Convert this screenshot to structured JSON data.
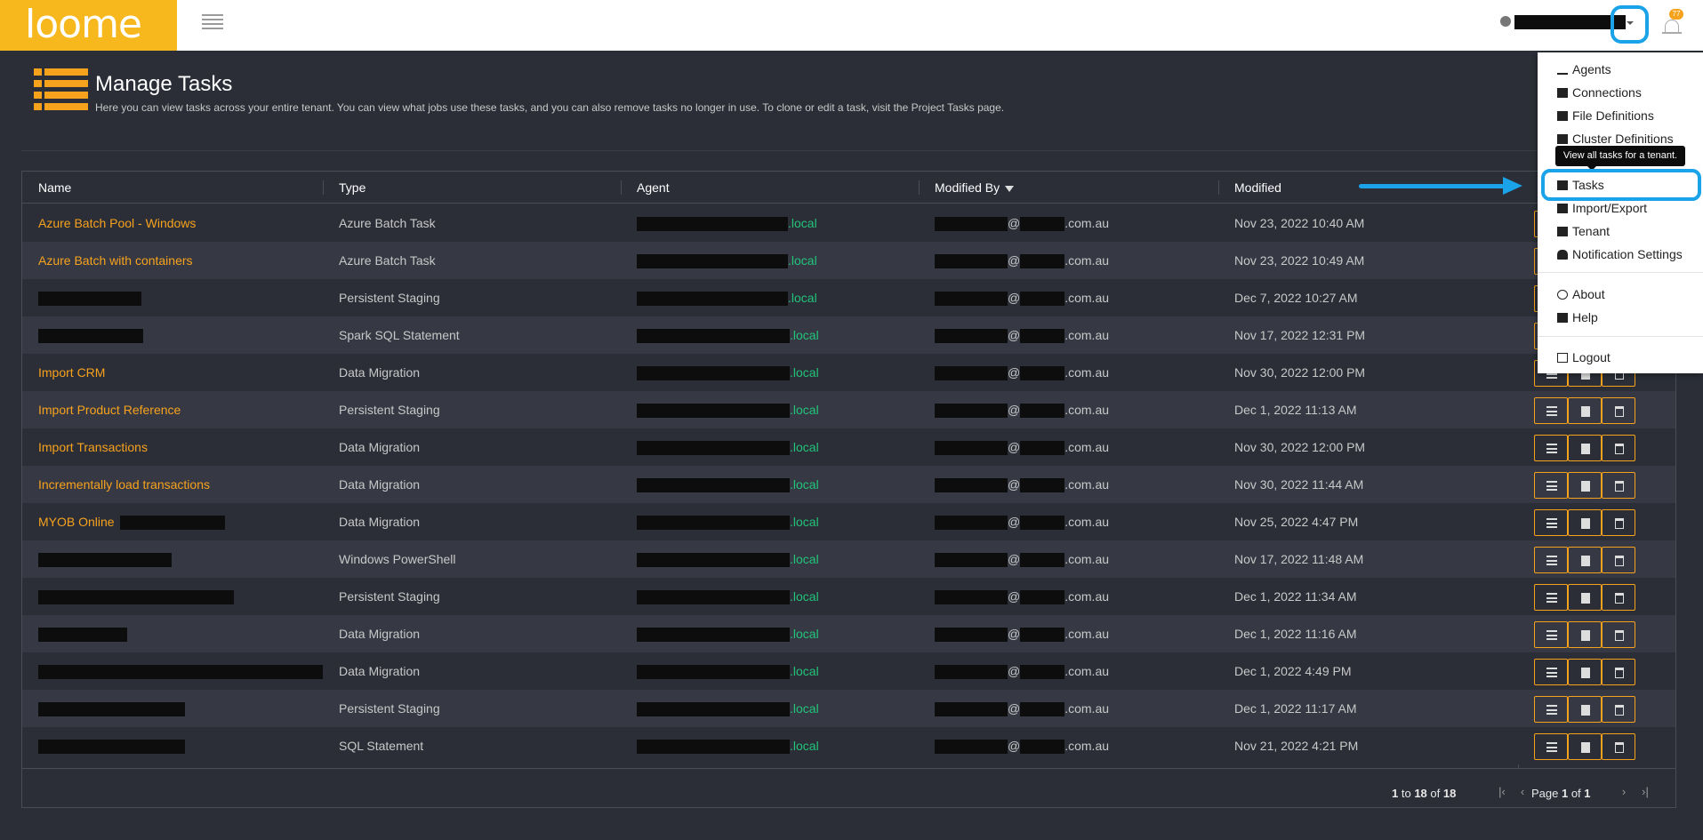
{
  "app": {
    "logo_text": "loome",
    "notification_count": "77"
  },
  "page": {
    "title": "Manage Tasks",
    "subtitle": "Here you can view tasks across your entire tenant. You can view what jobs use these tasks, and you can also remove tasks no longer in use. To clone or edit a task, visit the Project Tasks page."
  },
  "table": {
    "columns": {
      "name": "Name",
      "type": "Type",
      "agent": "Agent",
      "modified_by": "Modified By",
      "modified": "Modified"
    },
    "agent_suffix": ".local",
    "email_at": "@",
    "email_suffix": ".com.au",
    "rows": [
      {
        "name": "Azure Batch Pool - Windows",
        "type": "Azure Batch Task",
        "modified": "Nov 23, 2022 10:40 AM"
      },
      {
        "name": "Azure Batch with containers",
        "type": "Azure Batch Task",
        "modified": "Nov 23, 2022 10:49 AM"
      },
      {
        "name": "",
        "type": "Persistent Staging",
        "modified": "Dec 7, 2022 10:27 AM"
      },
      {
        "name": "",
        "type": "Spark SQL Statement",
        "modified": "Nov 17, 2022 12:31 PM"
      },
      {
        "name": "Import CRM",
        "type": "Data Migration",
        "modified": "Nov 30, 2022 12:00 PM"
      },
      {
        "name": "Import Product Reference",
        "type": "Persistent Staging",
        "modified": "Dec 1, 2022 11:13 AM"
      },
      {
        "name": "Import Transactions",
        "type": "Data Migration",
        "modified": "Nov 30, 2022 12:00 PM"
      },
      {
        "name": "Incrementally load transactions",
        "type": "Data Migration",
        "modified": "Nov 30, 2022 11:44 AM"
      },
      {
        "name": "MYOB Online",
        "type": "Data Migration",
        "modified": "Nov 25, 2022 4:47 PM"
      },
      {
        "name": "",
        "type": "Windows PowerShell",
        "modified": "Nov 17, 2022 11:48 AM"
      },
      {
        "name": "",
        "type": "Persistent Staging",
        "modified": "Dec 1, 2022 11:34 AM"
      },
      {
        "name": "",
        "type": "Data Migration",
        "modified": "Dec 1, 2022 11:16 AM"
      },
      {
        "name": "",
        "type": "Data Migration",
        "modified": "Dec 1, 2022 4:49 PM"
      },
      {
        "name": "",
        "type": "Persistent Staging",
        "modified": "Dec 1, 2022 11:17 AM"
      },
      {
        "name": "",
        "type": "SQL Statement",
        "modified": "Nov 21, 2022 4:21 PM"
      }
    ]
  },
  "pager": {
    "range_from": "1",
    "to_label": " to ",
    "range_to": "18",
    "of_label": " of ",
    "total": "18",
    "page_label": "Page ",
    "page_current": "1",
    "page_total": "1"
  },
  "menu": {
    "items": [
      "Agents",
      "Connections",
      "File Definitions",
      "Cluster Definitions",
      "Tasks",
      "Import/Export",
      "Tenant",
      "Notification Settings",
      "About",
      "Help",
      "Logout"
    ],
    "tooltip": "View all tasks for a tenant."
  },
  "colors": {
    "accent": "#f7a21d",
    "brand": "#f7b81d",
    "annotation": "#1aa3e8",
    "agent_green": "#22c47a",
    "background": "#2b2e37"
  }
}
